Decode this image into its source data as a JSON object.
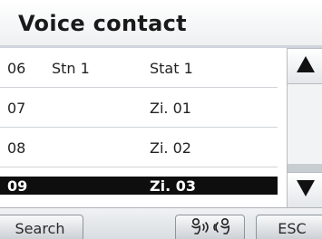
{
  "title": "Voice contact",
  "rows": [
    {
      "num": "06",
      "name": "Stn 1",
      "stat": "Stat 1",
      "selected": false
    },
    {
      "num": "07",
      "name": "",
      "stat": "Zi. 01",
      "selected": false
    },
    {
      "num": "08",
      "name": "",
      "stat": "Zi. 02",
      "selected": false
    },
    {
      "num": "09",
      "name": "",
      "stat": "Zi. 03",
      "selected": true
    }
  ],
  "buttons": {
    "search": "Search",
    "esc": "ESC"
  },
  "icons": {
    "scroll_up": "triangle-up-icon",
    "scroll_down": "triangle-down-icon",
    "voice_call": "voice-call-icon"
  }
}
